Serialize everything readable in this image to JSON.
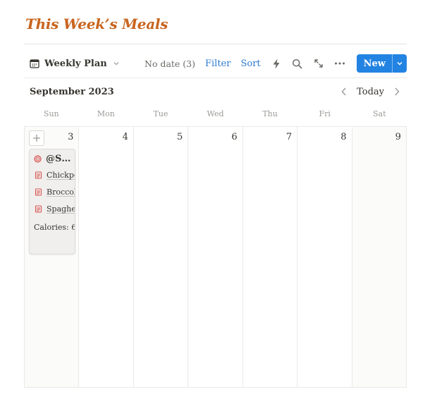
{
  "page": {
    "title": "This Week’s Meals"
  },
  "toolbar": {
    "view_label": "Weekly Plan",
    "no_date": "No date (3)",
    "filter": "Filter",
    "sort": "Sort",
    "new_label": "New",
    "icons": [
      "calendar-icon",
      "chevron-down-icon",
      "lightning-icon",
      "search-icon",
      "expand-icon",
      "more-icon"
    ]
  },
  "calendar": {
    "month_label": "September 2023",
    "today_label": "Today",
    "weekdays": [
      "Sun",
      "Mon",
      "Tue",
      "Wed",
      "Thu",
      "Fri",
      "Sat"
    ],
    "days": [
      "3",
      "4",
      "5",
      "6",
      "7",
      "8",
      "9"
    ]
  },
  "card": {
    "title": "@S…",
    "items": [
      "Chickpe",
      "Broccol",
      "Spaghet"
    ],
    "calories": "Calories: 6"
  },
  "colors": {
    "title": "#c8641e",
    "accent": "#2383e2",
    "link": "#2e7bd1",
    "card_bg": "#f0efed",
    "weekend_bg": "#fbfbfa",
    "recipe_icon": "#d9534f"
  }
}
